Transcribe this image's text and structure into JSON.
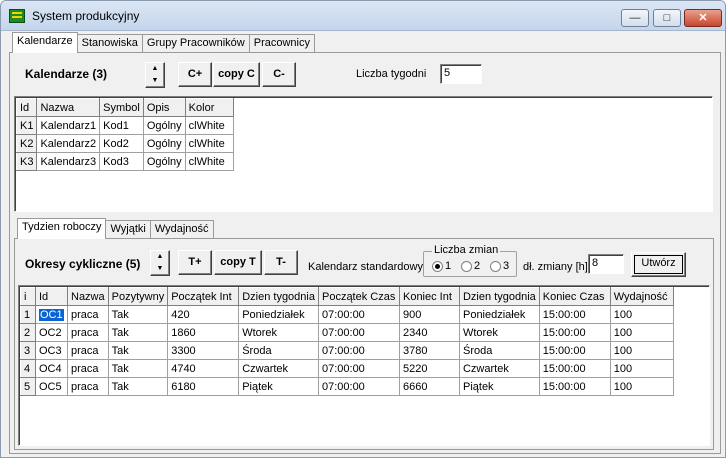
{
  "window": {
    "title": "System produkcyjny",
    "min_glyph": "—",
    "max_glyph": "□",
    "close_glyph": "✕"
  },
  "main_tabs": [
    "Kalendarze",
    "Stanowiska",
    "Grupy Pracowników",
    "Pracownicy"
  ],
  "calendars": {
    "heading": "Kalendarze (3)",
    "add_label": "C+",
    "copy_label": "copy C",
    "remove_label": "C-",
    "weeks_label": "Liczba tygodni",
    "weeks_value": "5",
    "columns": [
      "Id",
      "Nazwa",
      "Symbol",
      "Opis",
      "Kolor"
    ],
    "rows": [
      [
        "K1",
        "Kalendarz1",
        "Kod1",
        "Ogólny",
        "clWhite"
      ],
      [
        "K2",
        "Kalendarz2",
        "Kod2",
        "Ogólny",
        "clWhite"
      ],
      [
        "K3",
        "Kalendarz3",
        "Kod3",
        "Ogólny",
        "clWhite"
      ]
    ]
  },
  "sub_tabs": [
    "Tydzien roboczy",
    "Wyjątki",
    "Wydajność"
  ],
  "periods": {
    "heading": "Okresy cykliczne (5)",
    "add_label": "T+",
    "copy_label": "copy T",
    "remove_label": "T-",
    "standard_calendar_label": "Kalendarz standardowy",
    "shifts_group_label": "Liczba zmian",
    "shift_options": [
      "1",
      "2",
      "3"
    ],
    "shift_selected": "1",
    "shift_length_label": "dł. zmiany [h]",
    "shift_length_value": "8",
    "create_label": "Utwórz",
    "columns": [
      "i",
      "Id",
      "Nazwa",
      "Pozytywny",
      "Początek Int",
      "Dzien tygodnia",
      "Początek Czas",
      "Koniec Int",
      "Dzien tygodnia",
      "Koniec Czas",
      "Wydajność"
    ],
    "rows": [
      [
        "1",
        "OC1",
        "praca",
        "Tak",
        "420",
        "Poniedziałek",
        "07:00:00",
        "900",
        "Poniedziałek",
        "15:00:00",
        "100"
      ],
      [
        "2",
        "OC2",
        "praca",
        "Tak",
        "1860",
        "Wtorek",
        "07:00:00",
        "2340",
        "Wtorek",
        "15:00:00",
        "100"
      ],
      [
        "3",
        "OC3",
        "praca",
        "Tak",
        "3300",
        "Środa",
        "07:00:00",
        "3780",
        "Środa",
        "15:00:00",
        "100"
      ],
      [
        "4",
        "OC4",
        "praca",
        "Tak",
        "4740",
        "Czwartek",
        "07:00:00",
        "5220",
        "Czwartek",
        "15:00:00",
        "100"
      ],
      [
        "5",
        "OC5",
        "praca",
        "Tak",
        "6180",
        "Piątek",
        "07:00:00",
        "6660",
        "Piątek",
        "15:00:00",
        "100"
      ]
    ]
  },
  "colors": {
    "selection": "#0a64d8",
    "window_bg": "#f0f0f0"
  }
}
